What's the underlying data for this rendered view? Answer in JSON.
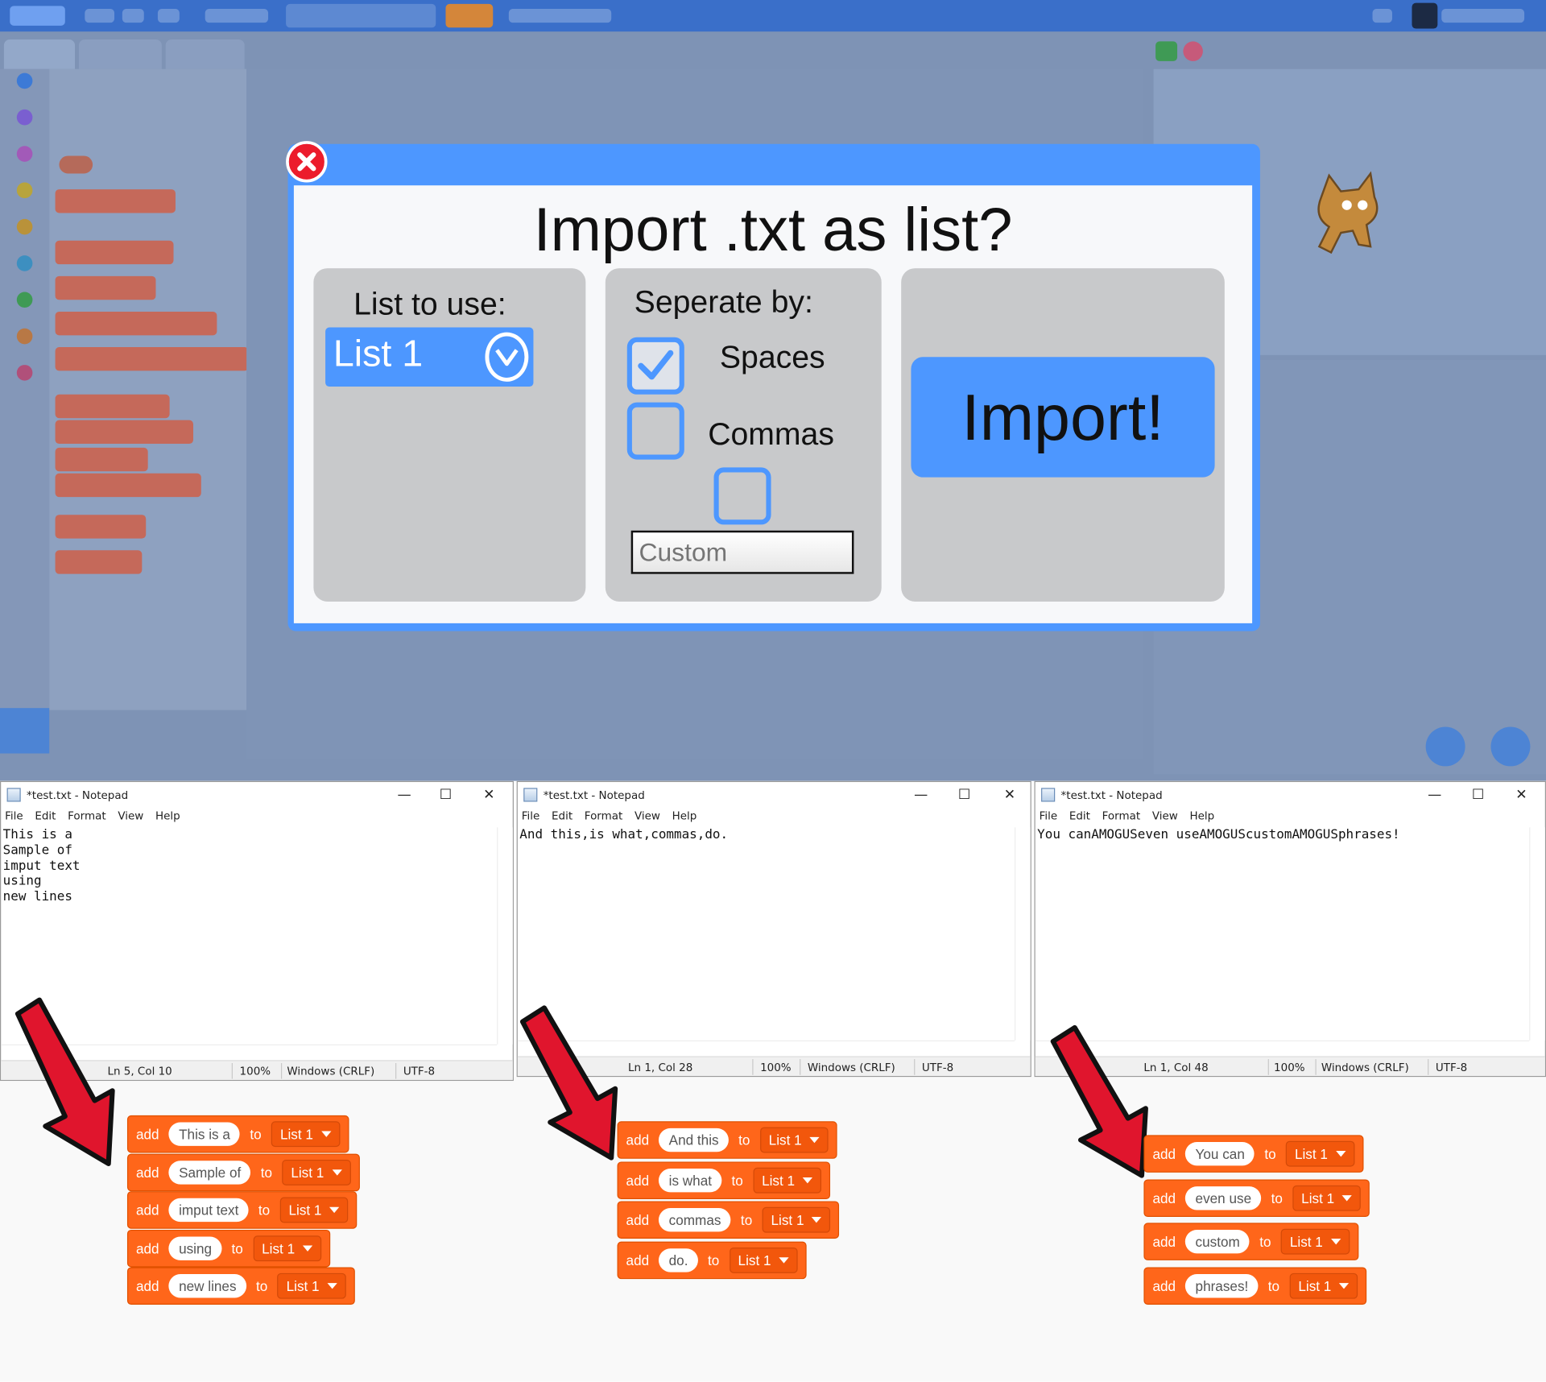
{
  "modal": {
    "title": "Import .txt as list?",
    "list_label": "List to use:",
    "list_value": "List 1",
    "separate_label": "Seperate by:",
    "options": [
      {
        "label": "Spaces",
        "checked": true
      },
      {
        "label": "Commas",
        "checked": false
      },
      {
        "label": "",
        "checked": false
      }
    ],
    "custom_placeholder": "Custom",
    "import_label": "Import!",
    "close_icon": "close-icon",
    "accent_color": "#4d97ff",
    "close_color": "#ec1c2c"
  },
  "notepads": [
    {
      "title": "*test.txt - Notepad",
      "menu": [
        "File",
        "Edit",
        "Format",
        "View",
        "Help"
      ],
      "content": "This is a\nSample of\nimput text\nusing\nnew lines",
      "status": {
        "position": "Ln 5, Col 10",
        "zoom": "100%",
        "line_ending": "Windows (CRLF)",
        "encoding": "UTF-8"
      }
    },
    {
      "title": "*test.txt - Notepad",
      "menu": [
        "File",
        "Edit",
        "Format",
        "View",
        "Help"
      ],
      "content": "And this,is what,commas,do.",
      "status": {
        "position": "Ln 1, Col 28",
        "zoom": "100%",
        "line_ending": "Windows (CRLF)",
        "encoding": "UTF-8"
      }
    },
    {
      "title": "*test.txt - Notepad",
      "menu": [
        "File",
        "Edit",
        "Format",
        "View",
        "Help"
      ],
      "content": "You canAMOGUSeven useAMOGUScustomAMOGUSphrases!",
      "status": {
        "position": "Ln 1, Col 48",
        "zoom": "100%",
        "line_ending": "Windows (CRLF)",
        "encoding": "UTF-8"
      }
    }
  ],
  "window_controls": {
    "minimize": "—",
    "maximize": "☐",
    "close": "✕"
  },
  "block_groups": [
    {
      "keyword": "add",
      "connector": "to",
      "list": "List 1",
      "items": [
        "This is a",
        "Sample of",
        "imput text",
        "using",
        "new lines"
      ]
    },
    {
      "keyword": "add",
      "connector": "to",
      "list": "List 1",
      "items": [
        "And this",
        "is what",
        "commas",
        "do."
      ]
    },
    {
      "keyword": "add",
      "connector": "to",
      "list": "List 1",
      "items": [
        "You can",
        "even use",
        "custom",
        "phrases!"
      ]
    }
  ],
  "arrow_color": "#e0152d",
  "block_color": "#ff661a"
}
